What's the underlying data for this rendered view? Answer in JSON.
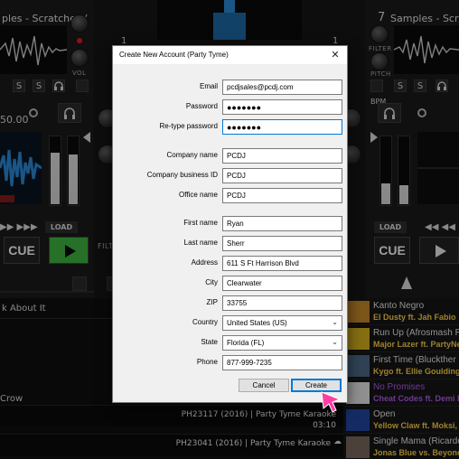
{
  "deck_left": {
    "title": "ples - Scratches (",
    "bpm_value": "50.00",
    "vol_label": "VOL",
    "cue_label": "CUE",
    "load_label": "LOAD",
    "transport_s": "S",
    "buttons": [
      "S",
      "S"
    ]
  },
  "deck_right": {
    "number": "7",
    "title": "Samples - Scratch",
    "bpm_label": "BPM",
    "filter_label": "FILTER",
    "pitch_label": "PITCH",
    "cue_label": "CUE",
    "load_label": "LOAD",
    "transport_s": "S",
    "buttons": [
      "S",
      "S"
    ]
  },
  "center": {
    "deck_num_left": "1",
    "deck_num_right": "1",
    "filt_label": "FILT"
  },
  "library": {
    "tree_item": "k About It",
    "crow_item": "Crow",
    "tracks": [
      {
        "meta": "PH23117 (2016) | Party Tyme Karaoke",
        "time": "03:10"
      },
      {
        "meta": "PH23041 (2016) | Party Tyme Karaoke",
        "time": ""
      }
    ]
  },
  "right_list": [
    {
      "title": "Kanto Negro",
      "artist": "El Dusty ft. Jah Fabio",
      "thumb": "#c98a2a",
      "title_color": "#e8e8e8",
      "artist_color": "#ffd14a"
    },
    {
      "title": "Run Up (Afrosmash R",
      "artist": "Major Lazer ft. PartyNex",
      "thumb": "#d8b21f",
      "title_color": "#e8e8e8",
      "artist_color": "#ffd14a"
    },
    {
      "title": "First Time (Bluckther",
      "artist": "Kygo ft. Ellie Goulding",
      "thumb": "#4d6b8a",
      "title_color": "#e8e8e8",
      "artist_color": "#ffd14a"
    },
    {
      "title": "No Promises",
      "artist": "Cheat Codes ft. Demi Lo",
      "thumb": "#e9e9e9",
      "title_color": "#b05cf0",
      "artist_color": "#b05cf0"
    },
    {
      "title": "Open",
      "artist": "Yellow Claw ft. Moksi, J",
      "thumb": "#2346a0",
      "title_color": "#e8e8e8",
      "artist_color": "#ffd14a"
    },
    {
      "title": "Single Mama (Ricardo",
      "artist": "Jonas Blue vs. Beyonce",
      "thumb": "#7a6a5e",
      "title_color": "#e8e8e8",
      "artist_color": "#ffd14a"
    }
  ],
  "dialog": {
    "title": "Create New Account (Party Tyme)",
    "close_glyph": "✕",
    "fields": [
      {
        "label": "Email",
        "value": "pcdjsales@pcdj.com"
      },
      {
        "label": "Password",
        "value": "●●●●●●●"
      },
      {
        "label": "Re-type password",
        "value": "●●●●●●●"
      },
      {
        "label": "Company name",
        "value": "PCDJ"
      },
      {
        "label": "Company business ID",
        "value": "PCDJ"
      },
      {
        "label": "Office name",
        "value": "PCDJ"
      },
      {
        "label": "First name",
        "value": "Ryan"
      },
      {
        "label": "Last name",
        "value": "Sherr"
      },
      {
        "label": "Address",
        "value": "611 S Ft Harrison Blvd"
      },
      {
        "label": "City",
        "value": "Clearwater"
      },
      {
        "label": "ZIP",
        "value": "33755"
      },
      {
        "label": "Country",
        "value": "United States (US)"
      },
      {
        "label": "State",
        "value": "Florida (FL)"
      },
      {
        "label": "Phone",
        "value": "877-999-7235"
      }
    ],
    "cancel_label": "Cancel",
    "create_label": "Create"
  },
  "colors": {
    "accent": "#0078d7",
    "play_green": "#3fb53f",
    "cursor_pink": "#ff3fa4",
    "waveform_blue": "#2a8ad8"
  }
}
